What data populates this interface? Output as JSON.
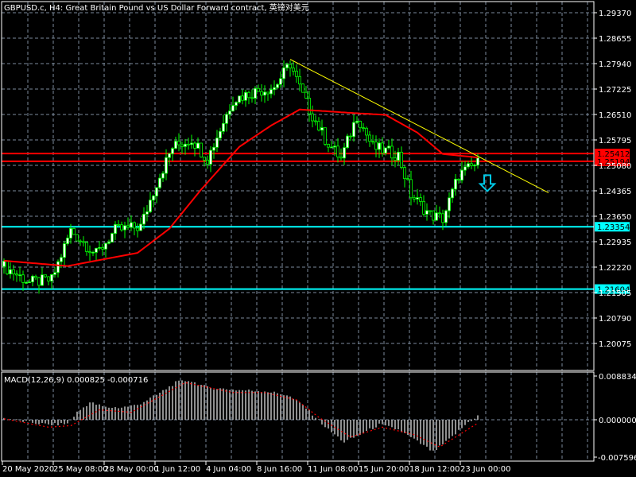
{
  "window": {
    "title": "GBPUSD.c, H4:  Great Britain Pound vs US Dollar Forward contract, 英镑对美元"
  },
  "colors": {
    "background": "#000000",
    "grid": "#7b8a9c",
    "candle_up": "#00ff00",
    "candle_body": "#ffffff",
    "ma": "#ff0000",
    "resistance": "#ff0000",
    "support": "#00ffff",
    "trendline": "#ffff00",
    "histogram": "#c0c0c0",
    "signal": "#ff0000",
    "arrow": "#00c8e6"
  },
  "chart_data": [
    {
      "type": "candlestick",
      "symbol": "GBPUSD.c",
      "timeframe": "H4",
      "ylim": [
        1.1945,
        1.298
      ],
      "y_ticks": [
        "1.29370",
        "1.28655",
        "1.27940",
        "1.27225",
        "1.26510",
        "1.25795",
        "1.25080",
        "1.24365",
        "1.23650",
        "1.22935",
        "1.22220",
        "1.21505",
        "1.20790",
        "1.20075"
      ],
      "x_ticks": [
        "20 May 2020",
        "25 May 08:00",
        "28 May 00:00",
        "1 Jun 12:00",
        "4 Jun 04:00",
        "8 Jun 16:00",
        "11 Jun 08:00",
        "15 Jun 20:00",
        "18 Jun 12:00",
        "23 Jun 00:00"
      ],
      "bar_count": 150,
      "close_path": [
        [
          0,
          1.2224
        ],
        [
          8,
          1.2179
        ],
        [
          15,
          1.2186
        ],
        [
          21,
          1.2325
        ],
        [
          29,
          1.2258
        ],
        [
          35,
          1.2325
        ],
        [
          43,
          1.2336
        ],
        [
          48,
          1.2459
        ],
        [
          53,
          1.2559
        ],
        [
          59,
          1.2582
        ],
        [
          64,
          1.2526
        ],
        [
          72,
          1.2693
        ],
        [
          79,
          1.2716
        ],
        [
          85,
          1.2727
        ],
        [
          90,
          1.2794
        ],
        [
          95,
          1.2682
        ],
        [
          101,
          1.2582
        ],
        [
          106,
          1.2526
        ],
        [
          111,
          1.2648
        ],
        [
          116,
          1.2559
        ],
        [
          124,
          1.2537
        ],
        [
          128,
          1.2425
        ],
        [
          134,
          1.2369
        ],
        [
          138,
          1.2358
        ],
        [
          143,
          1.2481
        ],
        [
          149,
          1.2515
        ]
      ],
      "ma_path": [
        [
          0,
          1.224
        ],
        [
          20,
          1.2225
        ],
        [
          42,
          1.2262
        ],
        [
          52,
          1.233
        ],
        [
          62,
          1.244
        ],
        [
          74,
          1.256
        ],
        [
          84,
          1.262
        ],
        [
          93,
          1.2665
        ],
        [
          110,
          1.2655
        ],
        [
          120,
          1.265
        ],
        [
          130,
          1.26
        ],
        [
          138,
          1.254
        ],
        [
          149,
          1.253
        ]
      ],
      "horizontal_lines": [
        {
          "price": 1.25412,
          "label": "1.25412",
          "color": "#ff0000"
        },
        {
          "price": 1.25194,
          "label": "1.25194",
          "color": "#ff0000"
        },
        {
          "price": 1.23354,
          "label": "1.23354",
          "color": "#00ffff"
        },
        {
          "price": 1.21604,
          "label": "1.21604",
          "color": "#00ffff"
        }
      ],
      "trendline": {
        "from": [
          90,
          1.2806
        ],
        "to": [
          171,
          1.2431
        ]
      },
      "signal_arrow": {
        "direction": "down",
        "bar": 152,
        "price": 1.244
      }
    },
    {
      "type": "bar",
      "indicator": "MACD",
      "label": "MACD(12,26,9) 0.000825 -0.000716",
      "ylim": [
        -0.007596,
        0.008834
      ],
      "y_ticks": [
        "0.008834",
        "0.000000",
        "-0.007596"
      ],
      "macd_path": [
        [
          0,
          0.0003
        ],
        [
          8,
          -0.0005
        ],
        [
          14,
          -0.001
        ],
        [
          20,
          -0.0008
        ],
        [
          23,
          0.0015
        ],
        [
          27,
          0.0035
        ],
        [
          32,
          0.0025
        ],
        [
          37,
          0.0025
        ],
        [
          42,
          0.003
        ],
        [
          48,
          0.005
        ],
        [
          54,
          0.0075
        ],
        [
          58,
          0.008
        ],
        [
          64,
          0.0065
        ],
        [
          74,
          0.006
        ],
        [
          82,
          0.0058
        ],
        [
          89,
          0.005
        ],
        [
          94,
          0.003
        ],
        [
          98,
          0.0005
        ],
        [
          102,
          -0.002
        ],
        [
          107,
          -0.0045
        ],
        [
          112,
          -0.003
        ],
        [
          118,
          -0.001
        ],
        [
          124,
          -0.002
        ],
        [
          129,
          -0.004
        ],
        [
          135,
          -0.0065
        ],
        [
          140,
          -0.004
        ],
        [
          146,
          -0.0005
        ],
        [
          149,
          0.0008
        ]
      ],
      "signal_path": [
        [
          0,
          0.0002
        ],
        [
          14,
          -0.0015
        ],
        [
          21,
          -0.0012
        ],
        [
          30,
          0.002
        ],
        [
          40,
          0.0015
        ],
        [
          57,
          0.0075
        ],
        [
          72,
          0.0055
        ],
        [
          82,
          0.0055
        ],
        [
          92,
          0.004
        ],
        [
          99,
          0.0005
        ],
        [
          109,
          -0.0035
        ],
        [
          119,
          -0.0015
        ],
        [
          129,
          -0.003
        ],
        [
          137,
          -0.0055
        ],
        [
          149,
          -0.0007
        ]
      ]
    }
  ]
}
